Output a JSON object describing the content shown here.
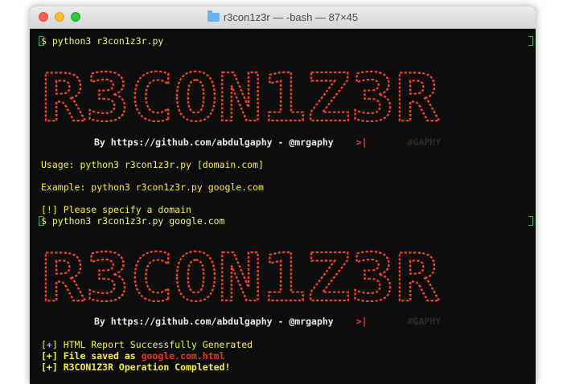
{
  "window": {
    "title": "r3con1z3r — -bash — 87×45"
  },
  "session1": {
    "command": "$ python3 r3con1z3r.py",
    "banner": "R3CON1Z3R",
    "byline": "By https://github.com/abdulgaphy - @mrgaphy",
    "cursor": ">|",
    "tag": "#GAPHY",
    "usage": "Usage: python3 r3con1z3r.py [domain.com]",
    "example": "Example: python3 r3con1z3r.py google.com",
    "error": "[!] Please specify a domain"
  },
  "session2": {
    "command": "$ python3 r3con1z3r.py google.com",
    "banner": "R3CON1Z3R",
    "byline": "By https://github.com/abdulgaphy - @mrgaphy",
    "cursor": ">|",
    "tag": "#GAPHY",
    "report": "[+] HTML Report Successfully Generated",
    "saved_prefix": "[+] File saved as ",
    "saved_file": "google.com.html",
    "completed": "[+] R3CON1Z3R Operation Completed!"
  },
  "colors": {
    "background": "#0d0d0d",
    "prompt": "#f3f07a",
    "text": "#f6ef48",
    "banner": "#e4492c",
    "bracket": "#2db84a"
  }
}
